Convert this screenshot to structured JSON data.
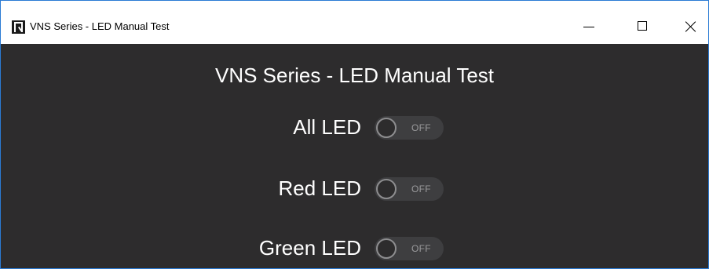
{
  "window": {
    "title": "VNS Series - LED Manual Test",
    "icon": "app-logo-icon",
    "controls": [
      "minimize-icon",
      "maximize-icon",
      "close-icon"
    ]
  },
  "main": {
    "title": "VNS Series - LED Manual Test",
    "leds": [
      {
        "label": "All LED",
        "state": "OFF"
      },
      {
        "label": "Red LED",
        "state": "OFF"
      },
      {
        "label": "Green LED",
        "state": "OFF"
      }
    ]
  },
  "colors": {
    "background": "#2d2c2d",
    "text": "#ffffff",
    "toggle_track": "#3e3e40",
    "toggle_knob_border": "#8d8d8f",
    "window_border": "#2b7bd4"
  }
}
